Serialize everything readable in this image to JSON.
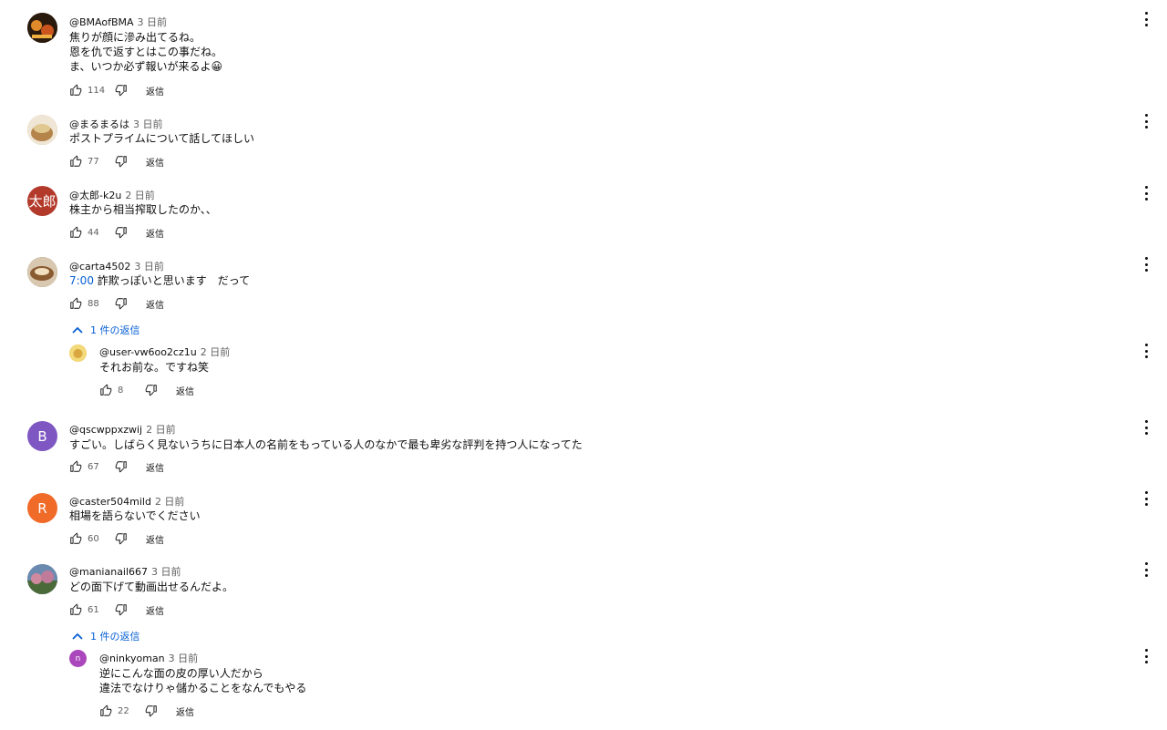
{
  "reply_label": "返信",
  "comments": [
    {
      "author": "@BMAofBMA",
      "time": "3 日前",
      "text": "焦りが顔に滲み出てるね。\n恩を仇で返すとはこの事だね。\nま、いつか必ず報いが来るよ😀",
      "likes": "114",
      "avatar_color": "#3a2414"
    },
    {
      "author": "@まるまるは",
      "time": "3 日前",
      "text": "ポストプライムについて話してほしい",
      "likes": "77",
      "avatar_color": "#c9a06a"
    },
    {
      "author": "@太郎-k2u",
      "time": "2 日前",
      "text": "株主から相当搾取したのか、、",
      "likes": "44",
      "avatar_text": "太郎",
      "avatar_color": "#b33a2a"
    },
    {
      "author": "@carta4502",
      "time": "3 日前",
      "timestamp_link": "7:00",
      "text": " 詐欺っぽいと思います　だって",
      "likes": "88",
      "avatar_color": "#7a5a3a",
      "replies_toggle": "1 件の返信",
      "reply": {
        "author": "@user-vw6oo2cz1u",
        "time": "2 日前",
        "text": "それお前な。ですね笑",
        "likes": "8",
        "avatar_color": "#e8c15a"
      }
    },
    {
      "author": "@qscwppxzwij",
      "time": "2 日前",
      "text": "すごい。しばらく見ないうちに日本人の名前をもっている人のなかで最も卑劣な評判を持つ人になってた",
      "likes": "67",
      "avatar_text": "B",
      "avatar_color": "#7e57c2"
    },
    {
      "author": "@caster504mild",
      "time": "2 日前",
      "text": "相場を語らないでください",
      "likes": "60",
      "avatar_text": "R",
      "avatar_color": "#f06a28"
    },
    {
      "author": "@manianail667",
      "time": "3 日前",
      "text": "どの面下げて動画出せるんだよ。",
      "likes": "61",
      "avatar_color": "#8a6a7a",
      "replies_toggle": "1 件の返信",
      "reply": {
        "author": "@ninkyoman",
        "time": "3 日前",
        "text": "逆にこんな面の皮の厚い人だから\n違法でなけりゃ儲かることをなんでもやる",
        "likes": "22",
        "avatar_text": "n",
        "avatar_color": "#ab47bc"
      }
    }
  ]
}
